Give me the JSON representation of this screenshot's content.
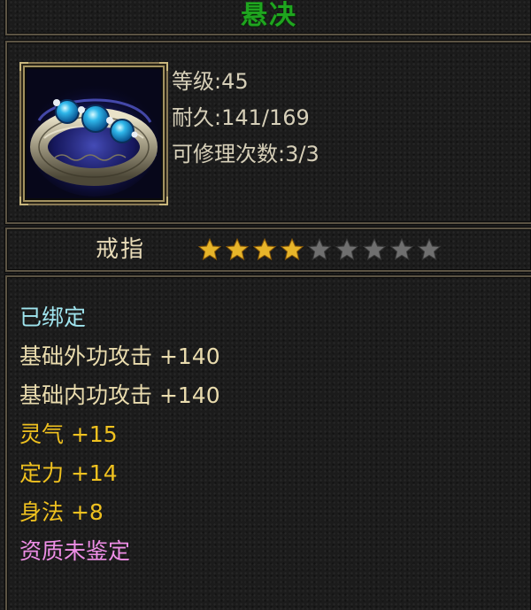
{
  "item": {
    "name": "悬决",
    "name_color": "#1fa51f",
    "icon": "ring-icon",
    "stats": [
      {
        "label": "等级",
        "value": "45",
        "text": "等级:45"
      },
      {
        "label": "耐久",
        "value": "141/169",
        "text": "耐久:141/169"
      },
      {
        "label": "可修理次数",
        "value": "3/3",
        "text": "可修理次数:3/3"
      }
    ],
    "type": "戒指",
    "stars": {
      "filled": 4,
      "total": 9,
      "filled_color": "#e7b52a",
      "empty_color": "#6f6f6f"
    },
    "attributes": [
      {
        "text": "已绑定",
        "kind": "bound",
        "color": "#9fe4ee"
      },
      {
        "text": "基础外功攻击 +140",
        "kind": "base",
        "color": "#eadcae"
      },
      {
        "text": "基础内功攻击 +140",
        "kind": "base",
        "color": "#eadcae"
      },
      {
        "text": "灵气 +15",
        "kind": "bonus",
        "color": "#efc11f"
      },
      {
        "text": "定力 +14",
        "kind": "bonus",
        "color": "#efc11f"
      },
      {
        "text": "身法 +8",
        "kind": "bonus",
        "color": "#efc11f"
      },
      {
        "text": "资质未鉴定",
        "kind": "quality",
        "color": "#ee8ee6"
      }
    ]
  }
}
